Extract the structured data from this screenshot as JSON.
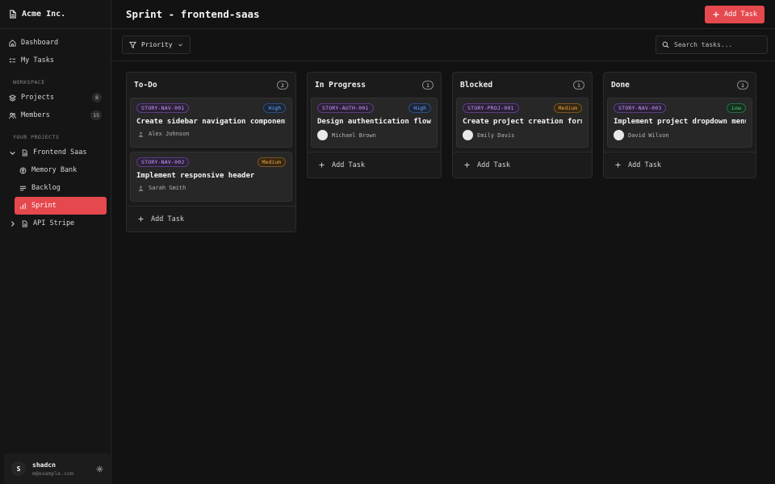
{
  "brand": {
    "name": "Acme Inc."
  },
  "nav": {
    "dashboard": "Dashboard",
    "my_tasks": "My Tasks",
    "workspace_label": "WORKSPACE",
    "projects": "Projects",
    "projects_count": "8",
    "members": "Members",
    "members_count": "15",
    "your_projects_label": "YOUR PROJECTS",
    "frontend_saas": "Frontend Saas",
    "memory_bank": "Memory Bank",
    "backlog": "Backlog",
    "sprint": "Sprint",
    "api_stripe": "API Stripe"
  },
  "user": {
    "initial": "S",
    "name": "shadcn",
    "email": "m@example.com"
  },
  "header": {
    "title": "Sprint - frontend-saas",
    "add_task": "Add Task"
  },
  "toolbar": {
    "filter": "Priority",
    "search_placeholder": "Search tasks..."
  },
  "columns": [
    {
      "title": "To-Do",
      "count": "2",
      "add_label": "Add Task",
      "cards": [
        {
          "id": "STORY-NAV-001",
          "priority": "High",
          "title": "Create sidebar navigation component",
          "assignee": "Alex Johnson"
        },
        {
          "id": "STORY-NAV-002",
          "priority": "Medium",
          "title": "Implement responsive header",
          "assignee": "Sarah Smith"
        }
      ]
    },
    {
      "title": "In Progress",
      "count": "1",
      "add_label": "Add Task",
      "cards": [
        {
          "id": "STORY-AUTH-001",
          "priority": "High",
          "title": "Design authentication flow",
          "assignee": "Michael Brown"
        }
      ]
    },
    {
      "title": "Blocked",
      "count": "1",
      "add_label": "Add Task",
      "cards": [
        {
          "id": "STORY-PROJ-001",
          "priority": "Medium",
          "title": "Create project creation form",
          "assignee": "Emily Davis"
        }
      ]
    },
    {
      "title": "Done",
      "count": "1",
      "add_label": "Add Task",
      "cards": [
        {
          "id": "STORY-NAV-003",
          "priority": "Low",
          "title": "Implement project dropdown menu",
          "assignee": "David Wilson"
        }
      ]
    }
  ],
  "colors": {
    "accent": "#e5484d",
    "high": "#6aa8ff",
    "medium": "#f2a541",
    "low": "#4fd27a",
    "story": "#c79bff"
  }
}
